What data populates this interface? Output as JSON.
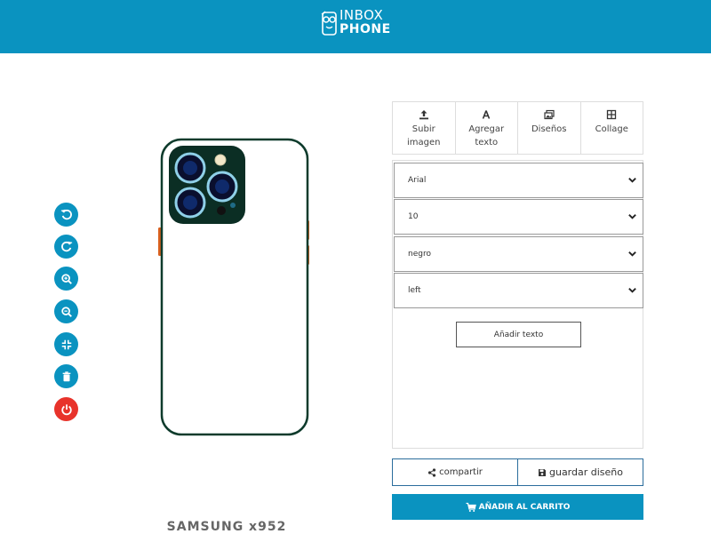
{
  "brand": {
    "line1": "INBOX",
    "line2": "PHONE"
  },
  "colors": {
    "header": "#0a93c0",
    "accent": "#0a93c0",
    "danger": "#e8332b",
    "phone_outline": "#0e3b2c"
  },
  "sidebar": {
    "buttons": [
      {
        "icon": "undo-icon"
      },
      {
        "icon": "redo-icon"
      },
      {
        "icon": "zoom-in-icon"
      },
      {
        "icon": "zoom-out-icon"
      },
      {
        "icon": "compress-icon"
      },
      {
        "icon": "trash-icon"
      },
      {
        "icon": "power-icon"
      }
    ]
  },
  "model": {
    "name": "SAMSUNG x952"
  },
  "tabs": [
    {
      "icon": "upload-icon",
      "label": "Subir imagen"
    },
    {
      "icon": "text-icon",
      "label": "Agregar texto"
    },
    {
      "icon": "images-icon",
      "label": "Diseños"
    },
    {
      "icon": "grid-icon",
      "label": "Collage"
    }
  ],
  "text_panel": {
    "font": "Arial",
    "size": "10",
    "color": "negro",
    "align": "left",
    "add_button": "Añadir texto"
  },
  "actions": {
    "share": "compartir",
    "save": "guardar diseño",
    "cart": "AÑADIR AL CARRITO"
  }
}
